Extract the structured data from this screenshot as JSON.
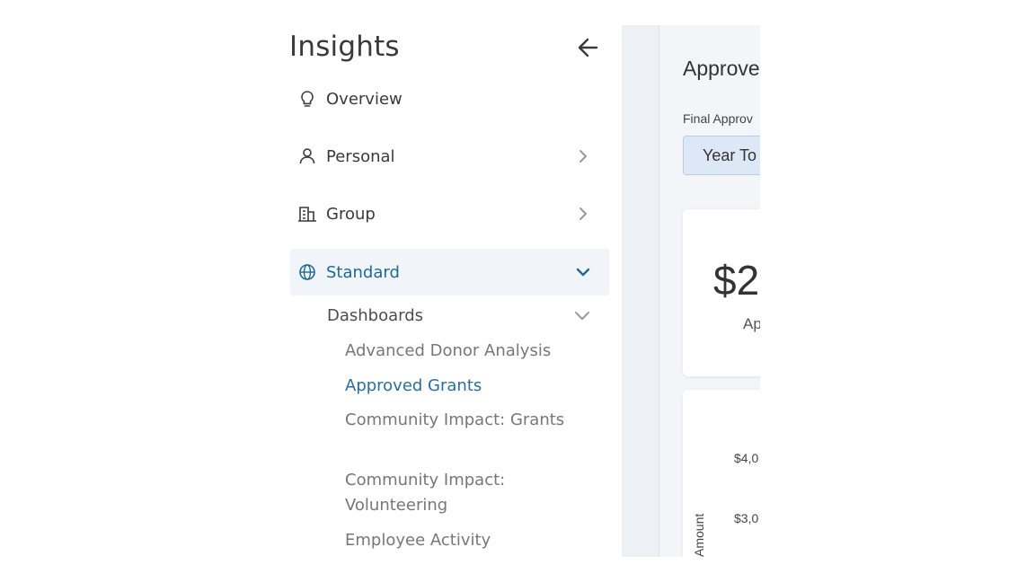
{
  "sidebar": {
    "title": "Insights",
    "back_icon": "arrow-left-icon",
    "items": [
      {
        "label": "Overview",
        "icon": "lightbulb-icon"
      },
      {
        "label": "Personal",
        "icon": "person-icon"
      },
      {
        "label": "Group",
        "icon": "building-icon"
      },
      {
        "label": "Standard",
        "icon": "globe-icon",
        "expanded": true
      }
    ],
    "dashboards": {
      "label": "Dashboards",
      "links": [
        {
          "label": "Advanced Donor Analysis"
        },
        {
          "label": "Approved Grants",
          "current": true
        },
        {
          "label": "Community Impact: Grants"
        },
        {
          "label": "Community Impact: Volunteering"
        },
        {
          "label": "Employee Activity"
        }
      ]
    }
  },
  "main": {
    "title": "Approve",
    "filter_label": "Final Approv",
    "filter_value": "Year To",
    "kpi": {
      "value": "$2",
      "label": "Ap"
    },
    "chart": {
      "y_axis_label": "Amount",
      "ticks": [
        "$4,0",
        "$3,0"
      ]
    }
  },
  "colors": {
    "accent": "#1f6a93",
    "active_bg": "#f1f4f8",
    "filter_bg": "#dce8f6",
    "main_bg": "#f3f5f8"
  }
}
